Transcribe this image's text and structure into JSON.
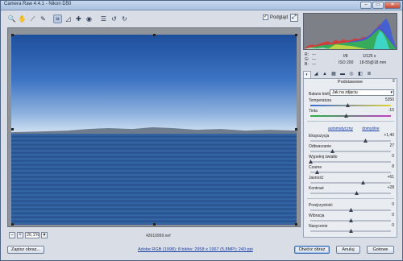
{
  "window": {
    "title": "Camera Raw 4.4.1  -  Nikon D50",
    "min_label": "–",
    "max_label": "▭",
    "close_label": "✕"
  },
  "toolbar": {
    "tools": [
      {
        "name": "zoom-tool-icon",
        "glyph": "🔍"
      },
      {
        "name": "hand-tool-icon",
        "glyph": "✋"
      },
      {
        "name": "white-balance-tool-icon",
        "glyph": "⟋"
      },
      {
        "name": "color-sampler-tool-icon",
        "glyph": "✎"
      },
      {
        "name": "crop-tool-icon",
        "glyph": "⌗",
        "selected": true
      },
      {
        "name": "straighten-tool-icon",
        "glyph": "◿"
      },
      {
        "name": "retouch-tool-icon",
        "glyph": "✚"
      },
      {
        "name": "red-eye-tool-icon",
        "glyph": "◉"
      },
      {
        "name": "preferences-icon",
        "glyph": "☰"
      },
      {
        "name": "rotate-ccw-icon",
        "glyph": "↺"
      },
      {
        "name": "rotate-cw-icon",
        "glyph": "↻"
      }
    ],
    "preview_label": "Podgląd",
    "preview_checked": "✓",
    "fullscreen_glyph": "⤢"
  },
  "preview": {
    "zoom_value": "26,1%",
    "zoom_out": "–",
    "zoom_in": "+",
    "zoom_arrow": "▾",
    "filename": "42610999.nef"
  },
  "histogram": {
    "colors": {
      "red": "#e03030",
      "green": "#30c040",
      "blue": "#3a5ae0",
      "yellow": "#e0e040",
      "magenta": "#e040e0",
      "cyan": "#40e0e0",
      "white": "#f5f5f5"
    }
  },
  "readout": {
    "r_label": "R:",
    "g_label": "G:",
    "b_label": "B:",
    "r_val": "---",
    "g_val": "---",
    "b_val": "---",
    "aperture": "f/8",
    "shutter": "1/125 s",
    "iso": "ISO 200",
    "lens": "18-55@18 mm"
  },
  "panel": {
    "title": "Podstawowe",
    "menu_glyph": "≡",
    "white_balance_label": "Balans bieli:",
    "white_balance_value": "Jak na zdjęciu",
    "link_auto": "automatyczny",
    "link_default": "domyślne",
    "sliders": [
      {
        "id": "temperature",
        "label": "Temperatura",
        "value": "5350",
        "pos": 0.46,
        "track": "temp"
      },
      {
        "id": "tint",
        "label": "Tinta",
        "value": "-15",
        "pos": 0.44,
        "track": "tint"
      },
      {
        "id": "exposure",
        "label": "Ekspozycja",
        "value": "+1,40",
        "pos": 0.68,
        "track": ""
      },
      {
        "id": "recovery",
        "label": "Odtwarzanie",
        "value": "27",
        "pos": 0.27,
        "track": ""
      },
      {
        "id": "fill-light",
        "label": "Wypełnij światło",
        "value": "0",
        "pos": 0.0,
        "track": ""
      },
      {
        "id": "blacks",
        "label": "Czarne",
        "value": "8",
        "pos": 0.08,
        "track": ""
      },
      {
        "id": "brightness",
        "label": "Jasność",
        "value": "+61",
        "pos": 0.65,
        "track": ""
      },
      {
        "id": "contrast",
        "label": "Kontrast",
        "value": "+28",
        "pos": 0.57,
        "track": ""
      },
      {
        "id": "clarity",
        "label": "Przejrzystość",
        "value": "0",
        "pos": 0.5,
        "track": ""
      },
      {
        "id": "vibrance",
        "label": "Wibracja",
        "value": "0",
        "pos": 0.5,
        "track": ""
      },
      {
        "id": "saturation",
        "label": "Nasycenie",
        "value": "0",
        "pos": 0.5,
        "track": ""
      }
    ]
  },
  "bottom": {
    "save_label": "Zapisz obraz...",
    "info_link": "Adobe RGB (1998); 8 bitów; 2958 x 1967 (5,8MP); 240 ppi",
    "open_label": "Otwórz obraz",
    "cancel_label": "Anuluj",
    "done_label": "Gotowe"
  }
}
